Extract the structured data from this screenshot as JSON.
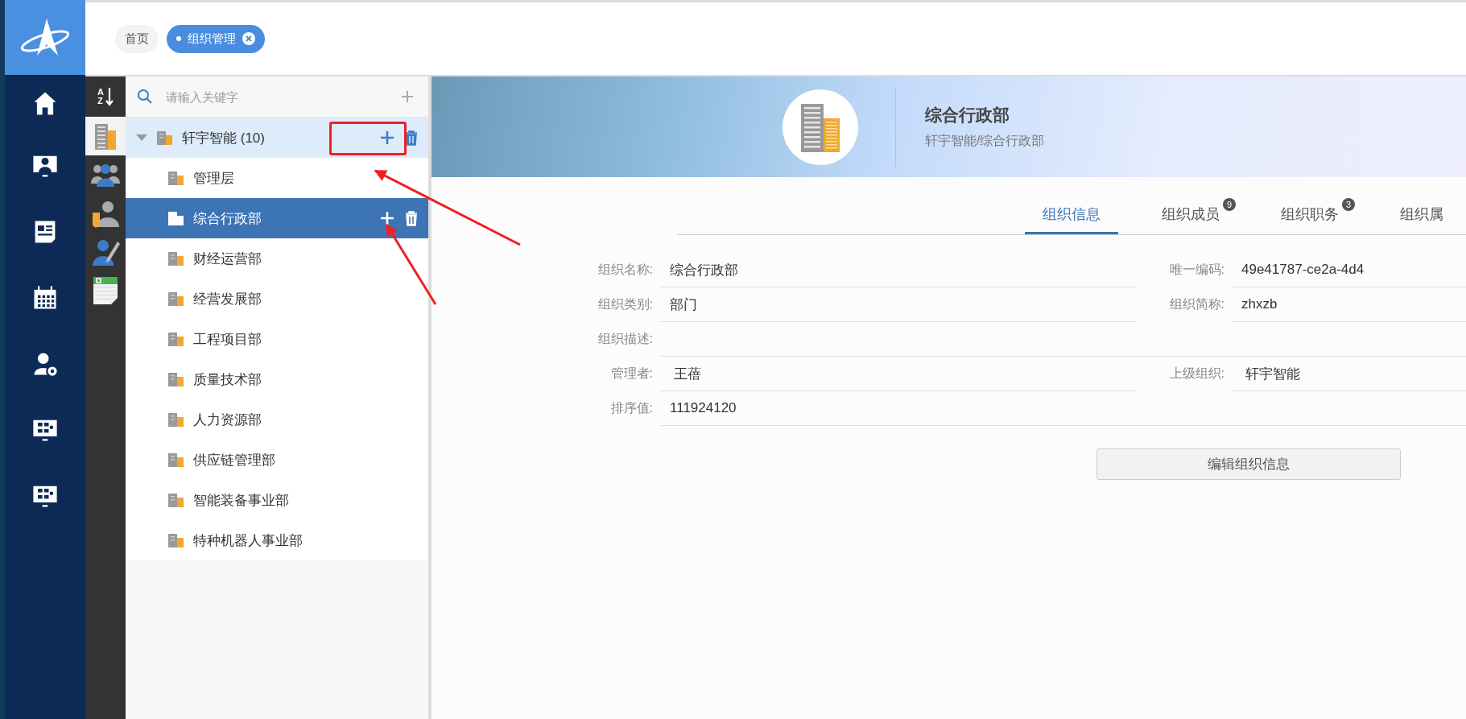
{
  "header": {
    "tabs": [
      {
        "label": "首页",
        "selected": false,
        "closable": false
      },
      {
        "label": "组织管理",
        "selected": true,
        "closable": true
      }
    ]
  },
  "nav": {
    "items": [
      {
        "kind": "home",
        "selected": false
      },
      {
        "kind": "monitor-person",
        "selected": false
      },
      {
        "kind": "news",
        "selected": false
      },
      {
        "kind": "calendar",
        "selected": false
      },
      {
        "kind": "user-gear",
        "selected": false
      },
      {
        "kind": "flowchart",
        "selected": false
      },
      {
        "kind": "flowchart",
        "selected": false
      }
    ]
  },
  "side_tools": {
    "sort": {
      "top": "A",
      "bottom": "Z"
    },
    "items": [
      {
        "kind": "building",
        "selected": true
      },
      {
        "kind": "group",
        "selected": false
      },
      {
        "kind": "person-tag",
        "selected": false
      },
      {
        "kind": "person-pencil",
        "selected": false
      },
      {
        "kind": "sheet",
        "selected": false
      }
    ]
  },
  "tree": {
    "search": {
      "placeholder": "请输入关键字"
    },
    "root": {
      "label": "轩宇智能 (10)",
      "expanded": true,
      "hovered": true,
      "children": [
        {
          "label": "管理层",
          "selected": false
        },
        {
          "label": "综合行政部",
          "selected": true
        },
        {
          "label": "财经运营部",
          "selected": false
        },
        {
          "label": "经营发展部",
          "selected": false
        },
        {
          "label": "工程项目部",
          "selected": false
        },
        {
          "label": "质量技术部",
          "selected": false
        },
        {
          "label": "人力资源部",
          "selected": false
        },
        {
          "label": "供应链管理部",
          "selected": false
        },
        {
          "label": "智能装备事业部",
          "selected": false
        },
        {
          "label": "特种机器人事业部",
          "selected": false
        }
      ]
    }
  },
  "banner": {
    "title": "综合行政部",
    "path": "轩宇智能/综合行政部"
  },
  "tabs": [
    {
      "label": "组织信息",
      "selected": true
    },
    {
      "label": "组织成员",
      "selected": false,
      "badge": "9"
    },
    {
      "label": "组织职务",
      "selected": false,
      "badge": "3"
    },
    {
      "label": "组织属",
      "selected": false
    }
  ],
  "form": {
    "rows": [
      [
        {
          "label": "组织名称:",
          "value": "综合行政部"
        },
        {
          "label": "唯一编码:",
          "value": "49e41787-ce2a-4d4"
        }
      ],
      [
        {
          "label": "组织类别:",
          "value": "部门"
        },
        {
          "label": "组织简称:",
          "value": "zhxzb"
        }
      ],
      [
        {
          "label": "组织描述:"
        }
      ],
      [
        {
          "label": "管理者:",
          "value": " 王蓓"
        },
        {
          "label": "上级组织:",
          "value": " 轩宇智能"
        }
      ],
      [
        {
          "label": "排序值:",
          "value": "111924120"
        }
      ]
    ],
    "button": "编辑组织信息"
  }
}
